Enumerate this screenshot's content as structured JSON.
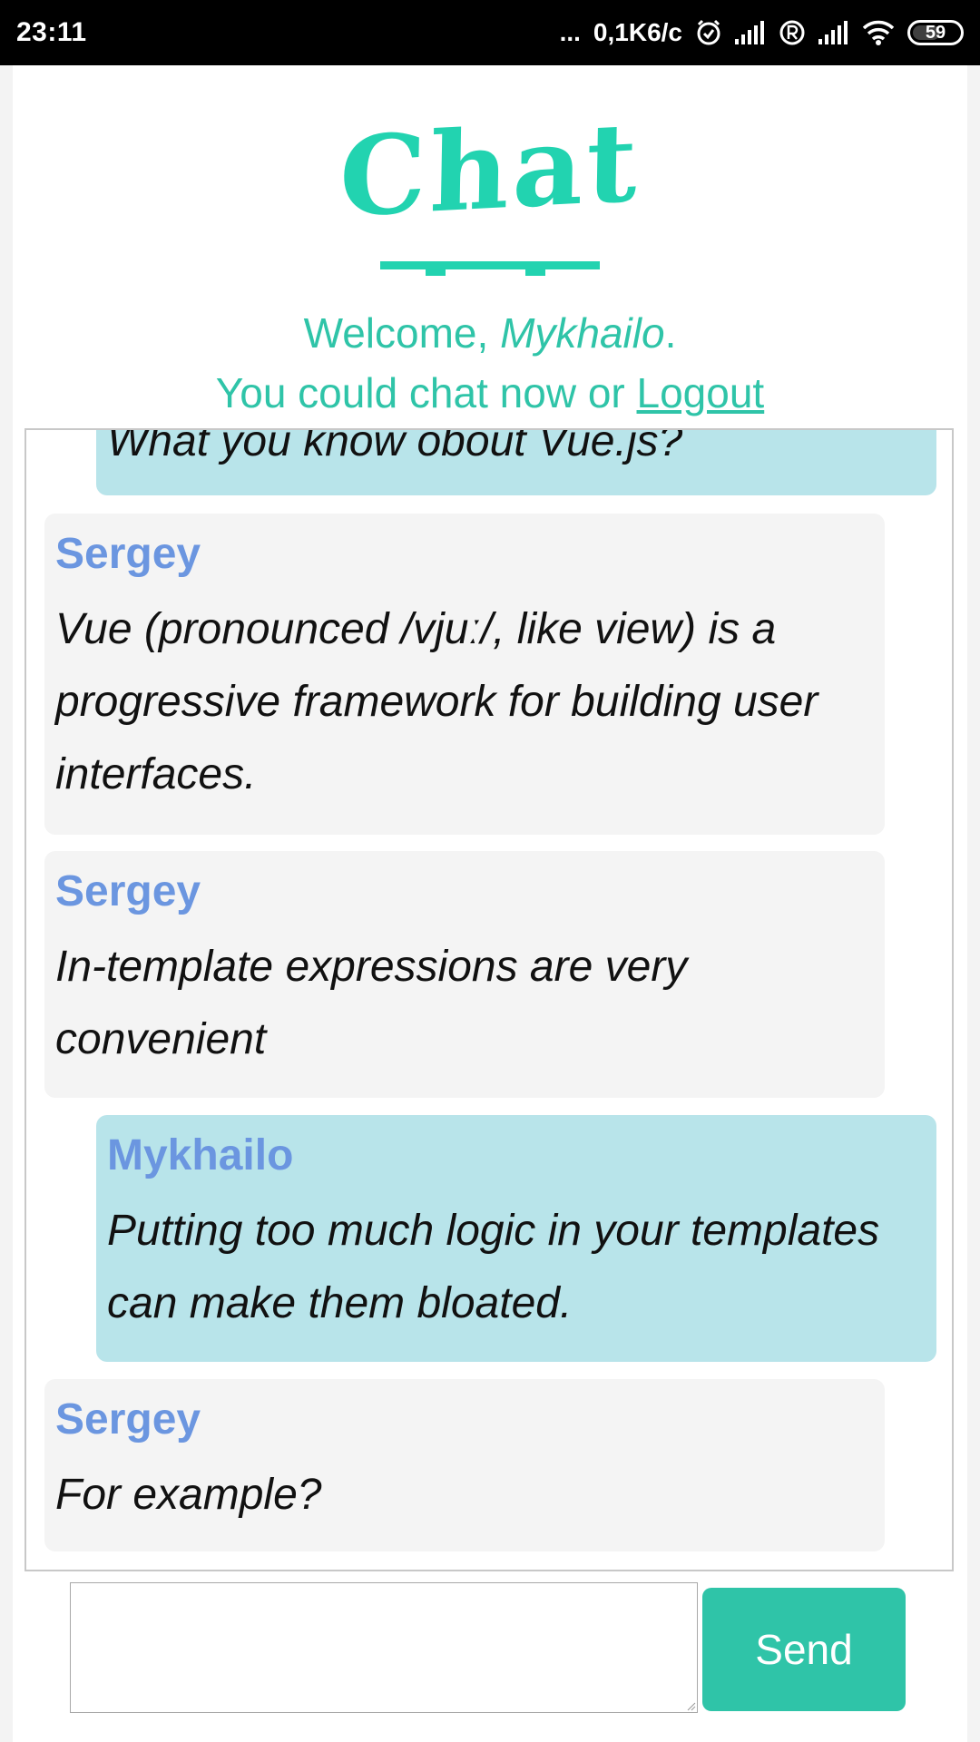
{
  "status_bar": {
    "time": "23:11",
    "more": "...",
    "speed": "0,1K6/c",
    "battery": "59",
    "icons": [
      "alarm-icon",
      "signal-icon",
      "roaming-icon",
      "signal-icon",
      "wifi-icon",
      "battery-icon"
    ]
  },
  "header": {
    "logo_text": "Chat",
    "welcome_prefix": "Welcome, ",
    "user_name": "Mykhailo",
    "welcome_suffix": ".",
    "chat_prompt": "You could chat now or ",
    "logout_label": "Logout"
  },
  "messages": [
    {
      "author": "",
      "text": "What you know obout Vue.js?",
      "mine": true
    },
    {
      "author": "Sergey",
      "text": "Vue (pronounced /vjuː/, like view) is a progressive framework for building user interfaces.",
      "mine": false
    },
    {
      "author": "Sergey",
      "text": "In-template expressions are very convenient",
      "mine": false
    },
    {
      "author": "Mykhailo",
      "text": "Putting too much logic in your templates can make them bloated.",
      "mine": true
    },
    {
      "author": "Sergey",
      "text": "For example?",
      "mine": false
    }
  ],
  "composer": {
    "value": "",
    "send_label": "Send"
  },
  "colors": {
    "accent": "#2fc4a8",
    "logo": "#22d3b0",
    "author": "#6b96e0",
    "own_bubble": "#b8e4ea",
    "other_bubble": "#f4f4f4"
  }
}
